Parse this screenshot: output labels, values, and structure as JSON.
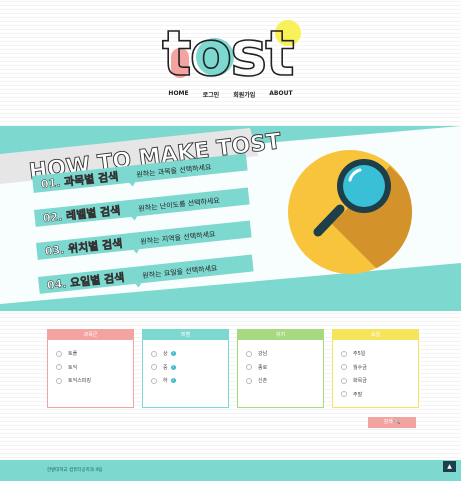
{
  "logo": {
    "text": "tost"
  },
  "nav": {
    "items": [
      "HOME",
      "로그인",
      "회원가입",
      "ABOUT"
    ]
  },
  "hero": {
    "title": "HOW TO MAKE TOST",
    "steps": [
      {
        "label": "01. 과목별 검색",
        "desc": "원하는 과목을 선택하세요"
      },
      {
        "label": "02. 레벨별 검색",
        "desc": "원하는 난이도를 선택하세요"
      },
      {
        "label": "03. 위치별 검색",
        "desc": "원하는 지역을 선택하세요"
      },
      {
        "label": "04. 요일별 검색",
        "desc": "원하는 요일을 선택하세요"
      }
    ]
  },
  "filters": [
    {
      "title": "과목군",
      "color": "#f4a4a0",
      "options": [
        "토플",
        "토익",
        "토익스피킹"
      ]
    },
    {
      "title": "레벨",
      "color": "#7dd8cf",
      "options": [
        "상",
        "중",
        "하"
      ]
    },
    {
      "title": "위치",
      "color": "#a7d97e",
      "options": [
        "강남",
        "종로",
        "신촌"
      ]
    },
    {
      "title": "요일",
      "color": "#f5e45c",
      "options": [
        "주5일",
        "월수금",
        "화목금",
        "주말"
      ]
    }
  ],
  "search": {
    "label": "검색 🔍"
  },
  "footer": {
    "text": "한밭대학교 컴퓨터공학과 4팀"
  },
  "top_button": {
    "label": "▲"
  },
  "colors": {
    "teal": "#7dd8cf",
    "pink": "#f4a4a0",
    "green": "#a7d97e",
    "yellow": "#f5e45c",
    "circle": "#f8c43c",
    "shadow": "#d4932a"
  }
}
